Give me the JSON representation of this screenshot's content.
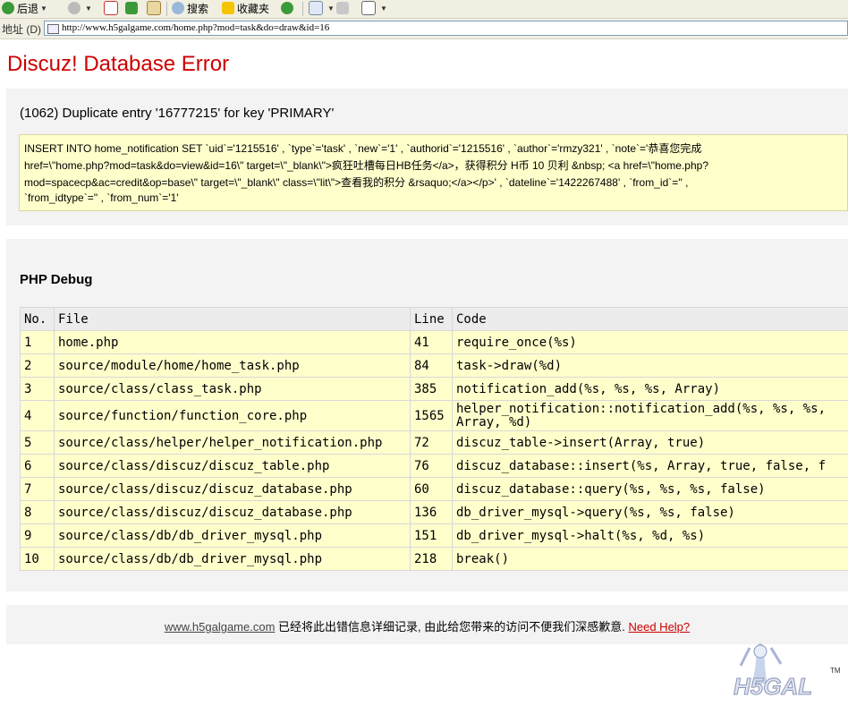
{
  "toolbar": {
    "back_label": "后退",
    "search_label": "搜索",
    "favorites_label": "收藏夹"
  },
  "address": {
    "label": "地址 (D)",
    "url": "http://www.h5galgame.com/home.php?mod=task&do=draw&id=16"
  },
  "error": {
    "title": "Discuz! Database Error",
    "message": "(1062) Duplicate entry '16777215' for key 'PRIMARY'",
    "sql_lines": [
      "INSERT INTO home_notification SET `uid`='1215516' , `type`='task' , `new`='1' , `authorid`='1215516' , `author`='rmzy321' , `note`='恭喜您完成",
      "href=\\\"home.php?mod=task&do=view&id=16\\\" target=\\\"_blank\\\">疯狂吐槽每日HB任务</a>，获得积分 H币 10 贝利 &nbsp; <a href=\\\"home.php?",
      "mod=spacecp&ac=credit&op=base\\\" target=\\\"_blank\\\" class=\\\"lit\\\">查看我的积分 &rsaquo;</a></p>' , `dateline`='1422267488' , `from_id`='' ,",
      "`from_idtype`='' , `from_num`='1'"
    ]
  },
  "debug": {
    "title": "PHP Debug",
    "headers": {
      "no": "No.",
      "file": "File",
      "line": "Line",
      "code": "Code"
    },
    "rows": [
      {
        "no": "1",
        "file": "home.php",
        "line": "41",
        "code": "require_once(%s)"
      },
      {
        "no": "2",
        "file": "source/module/home/home_task.php",
        "line": "84",
        "code": "task->draw(%d)"
      },
      {
        "no": "3",
        "file": "source/class/class_task.php",
        "line": "385",
        "code": "notification_add(%s, %s, %s, Array)"
      },
      {
        "no": "4",
        "file": "source/function/function_core.php",
        "line": "1565",
        "code": "helper_notification::notification_add(%s, %s, %s, Array, %d)"
      },
      {
        "no": "5",
        "file": "source/class/helper/helper_notification.php",
        "line": "72",
        "code": "discuz_table->insert(Array, true)"
      },
      {
        "no": "6",
        "file": "source/class/discuz/discuz_table.php",
        "line": "76",
        "code": "discuz_database::insert(%s, Array, true, false, f"
      },
      {
        "no": "7",
        "file": "source/class/discuz/discuz_database.php",
        "line": "60",
        "code": "discuz_database::query(%s, %s, %s, false)"
      },
      {
        "no": "8",
        "file": "source/class/discuz/discuz_database.php",
        "line": "136",
        "code": "db_driver_mysql->query(%s, %s, false)"
      },
      {
        "no": "9",
        "file": "source/class/db/db_driver_mysql.php",
        "line": "151",
        "code": "db_driver_mysql->halt(%s, %d, %s)"
      },
      {
        "no": "10",
        "file": "source/class/db/db_driver_mysql.php",
        "line": "218",
        "code": "break()"
      }
    ]
  },
  "footer": {
    "site": "www.h5galgame.com",
    "text": " 已经将此出错信息详细记录, 由此给您带来的访问不便我们深感歉意. ",
    "help": "Need Help?"
  },
  "logo": {
    "text": "H5GAL",
    "tm": "TM"
  }
}
